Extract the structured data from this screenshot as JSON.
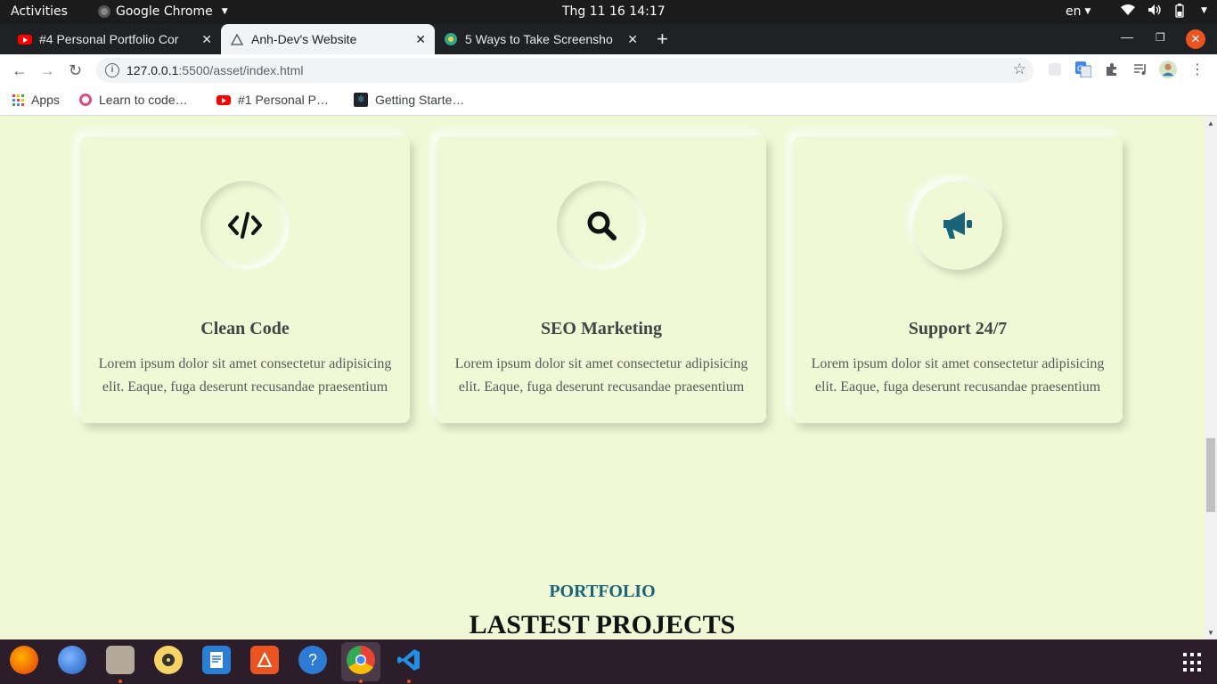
{
  "topbar": {
    "activities": "Activities",
    "app_name": "Google Chrome",
    "clock": "Thg 11 16  14:17",
    "language": "en"
  },
  "tabs": [
    {
      "title": "#4 Personal Portfolio Cor",
      "icon": "youtube-icon",
      "active": false
    },
    {
      "title": "Anh-Dev's Website",
      "icon": "triangle-icon",
      "active": true
    },
    {
      "title": "5 Ways to Take Screensho",
      "icon": "gear-favicon-icon",
      "active": false
    }
  ],
  "address": {
    "host": "127.0.0.1",
    "path": ":5500/asset/index.html"
  },
  "bookmarks": [
    {
      "label": "Apps",
      "icon": "apps-grid-icon"
    },
    {
      "label": "Learn to code…",
      "icon": "freecodecamp-icon"
    },
    {
      "label": "#1 Personal P…",
      "icon": "youtube-icon"
    },
    {
      "label": "Getting Starte…",
      "icon": "react-icon"
    }
  ],
  "services": [
    {
      "title": "Clean Code",
      "text": "Lorem ipsum dolor sit amet consectetur adipisicing elit. Eaque, fuga deserunt recusandae praesentium",
      "icon": "code-icon"
    },
    {
      "title": "SEO Marketing",
      "text": "Lorem ipsum dolor sit amet consectetur adipisicing elit. Eaque, fuga deserunt recusandae praesentium",
      "icon": "search-icon"
    },
    {
      "title": "Support 24/7",
      "text": "Lorem ipsum dolor sit amet consectetur adipisicing elit. Eaque, fuga deserunt recusandae praesentium",
      "icon": "megaphone-icon"
    }
  ],
  "portfolio": {
    "label": "PORTFOLIO",
    "title": "LASTEST PROJECTS"
  },
  "colors": {
    "page_bg": "#f0f8d6",
    "accent": "#18657a",
    "topbar_bg": "#1c1c1c",
    "tabstrip_bg": "#202124",
    "dock_bg": "#2b1d2a",
    "window_close": "#e95420"
  },
  "dock": [
    "firefox-icon",
    "thunderbird-icon",
    "files-icon",
    "rhythmbox-icon",
    "writer-icon",
    "software-icon",
    "help-icon",
    "chrome-icon",
    "vscode-icon",
    "show-apps-icon"
  ]
}
